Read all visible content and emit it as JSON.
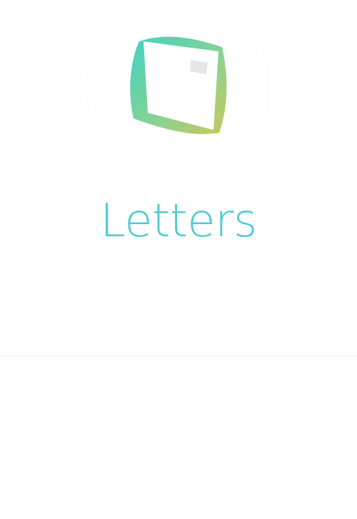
{
  "app": {
    "title": "Letters"
  },
  "logo": {
    "icon": "letters-logo-icon",
    "gradient_start": "#3fd3c4",
    "gradient_mid": "#7fd09a",
    "gradient_end": "#c9c85a",
    "stamp_color": "#e6e6e6"
  },
  "colors": {
    "title": "#4ecbd3",
    "background": "#ffffff",
    "divider": "#f1f1f1"
  }
}
